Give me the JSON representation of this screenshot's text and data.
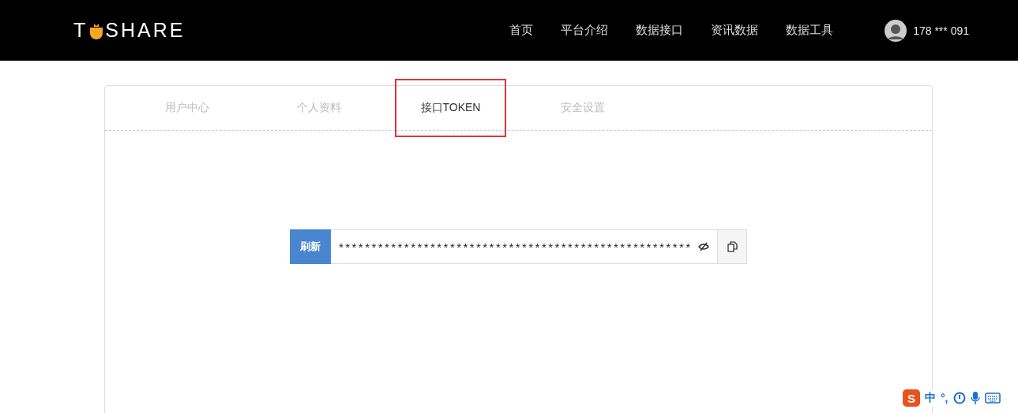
{
  "header": {
    "logo": {
      "left": "T",
      "right": "SHARE"
    },
    "nav": [
      {
        "label": "首页"
      },
      {
        "label": "平台介绍"
      },
      {
        "label": "数据接口"
      },
      {
        "label": "资讯数据"
      },
      {
        "label": "数据工具"
      }
    ],
    "user": {
      "name": "178 *** 091"
    }
  },
  "tabs": [
    {
      "label": "用户中心",
      "selected": false,
      "highlighted": false
    },
    {
      "label": "个人资料",
      "selected": false,
      "highlighted": false
    },
    {
      "label": "接口TOKEN",
      "selected": true,
      "highlighted": true
    },
    {
      "label": "安全设置",
      "selected": false,
      "highlighted": false
    }
  ],
  "token": {
    "refresh_button": "刷新",
    "value": "******************************************************",
    "masked": true
  },
  "ime_bar": {
    "logo": "S",
    "mode": "中",
    "punct": "°,"
  }
}
